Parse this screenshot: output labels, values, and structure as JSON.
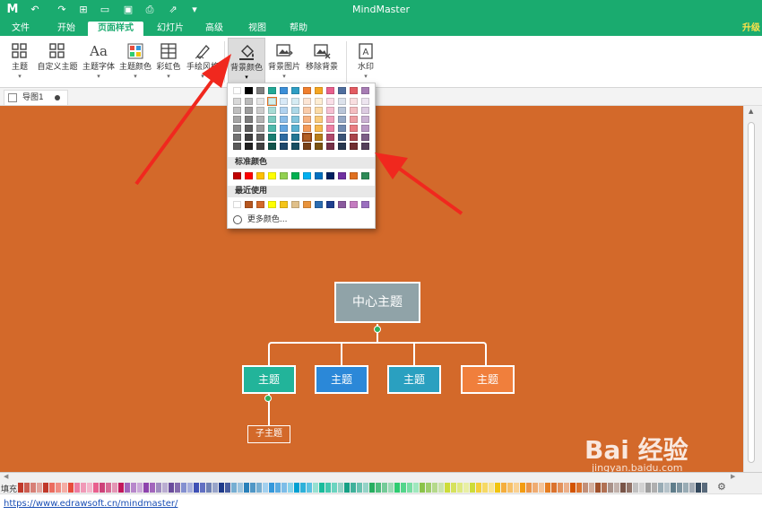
{
  "app": {
    "title": "MindMaster",
    "logo": "M"
  },
  "menu": {
    "tabs": [
      "文件",
      "开始",
      "页面样式",
      "幻灯片",
      "高级",
      "视图",
      "帮助"
    ],
    "active": "页面样式",
    "upgrade": "升级"
  },
  "ribbon": {
    "buttons": [
      {
        "label": "主题",
        "icon": "theme-grid-icon"
      },
      {
        "label": "自定义主题",
        "icon": "custom-theme-icon"
      },
      {
        "label": "主题字体",
        "icon": "font-icon"
      },
      {
        "label": "主题颜色",
        "icon": "palette-icon"
      },
      {
        "label": "彩虹色",
        "icon": "rainbow-icon"
      },
      {
        "label": "手绘风格",
        "icon": "hand-drawn-icon"
      },
      {
        "label": "背景颜色",
        "icon": "paint-bucket-icon"
      },
      {
        "label": "背景图片",
        "icon": "background-image-icon"
      },
      {
        "label": "移除背景",
        "icon": "remove-background-icon"
      },
      {
        "label": "水印",
        "icon": "watermark-icon"
      }
    ]
  },
  "document": {
    "tab_name": "导图1"
  },
  "canvas": {
    "background": "#d3692a"
  },
  "mindmap": {
    "center": "中心主题",
    "topics": [
      "主题",
      "主题",
      "主题",
      "主题"
    ],
    "subtopic": "子主题",
    "topic_colors": [
      "#22b49a",
      "#2b88d8",
      "#2aa0c0",
      "#f07f3c"
    ],
    "center_color": "#90a3a8"
  },
  "color_popup": {
    "standard_label": "标准颜色",
    "recent_label": "最近使用",
    "more_label": "更多颜色...",
    "theme_base": [
      "#ffffff",
      "#000000",
      "#7f7f7f",
      "#23a896",
      "#3c8fd8",
      "#2f9ec4",
      "#f07f2e",
      "#f5a623",
      "#e8608e",
      "#4f6e9e",
      "#e35b62",
      "#a77db4"
    ],
    "standard": [
      "#c00000",
      "#ff0000",
      "#ffc000",
      "#ffff00",
      "#92d050",
      "#00b050",
      "#00b0f0",
      "#0070c0",
      "#002060",
      "#7030a0",
      "#e07020",
      "#2e8b57"
    ],
    "recent": [
      "#ffffff",
      "#b5561f",
      "#d3692a",
      "#ffff00",
      "#f5c518",
      "#e0c08a",
      "#e8933c",
      "#2b6cb0",
      "#1f3f8f",
      "#8a5a9e",
      "#c47cc0",
      "#9b6fbf"
    ]
  },
  "colorbar": {
    "label": "填充"
  },
  "status": {
    "url": "https://www.edrawsoft.cn/mindmaster/"
  },
  "watermark": {
    "text": "Bai 经验",
    "sub": "jingyan.baidu.com"
  }
}
